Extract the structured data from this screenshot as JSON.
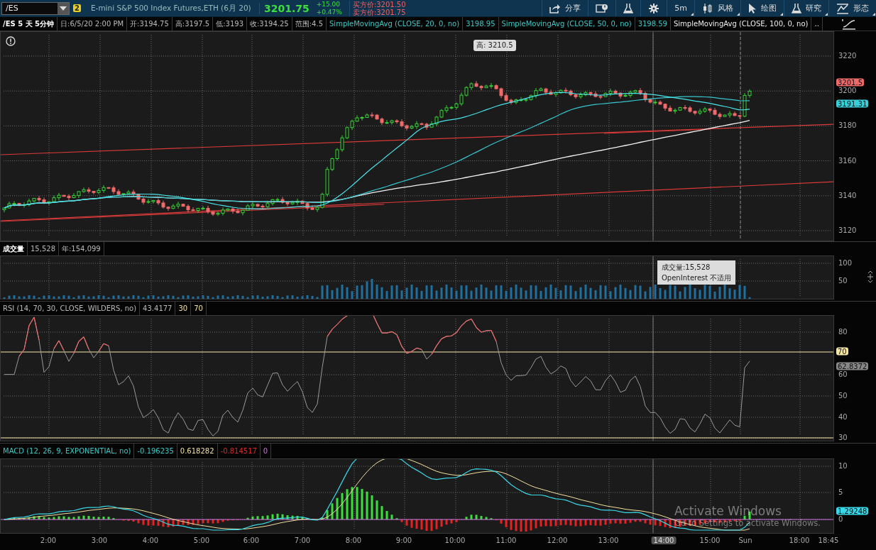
{
  "toolbar": {
    "symbol": "/ES",
    "link_badge": "2",
    "description": "E-mini S&P 500 Index Futures,ETH (6月 20)",
    "last": "3201.75",
    "change": "+15.00",
    "change_pct": "+0.47%",
    "bid": "买方价:3201.50",
    "ask": "卖方价:3201.75",
    "buttons": [
      {
        "label": "分享",
        "has_menu": false
      },
      {
        "has_menu": false
      },
      {
        "has_menu": false
      },
      {
        "has_menu": false
      },
      {
        "label": "5m",
        "has_menu": true
      },
      {
        "label": "风格",
        "has_menu": true
      },
      {
        "label": "绘图",
        "has_menu": true
      },
      {
        "label": "研究",
        "has_menu": true
      },
      {
        "label": "形态",
        "has_menu": true
      }
    ]
  },
  "info_bar": [
    {
      "text": "/ES 5 天 5分钟",
      "kind": "symbol"
    },
    {
      "text": "日:6/5/20 2:00 PM",
      "kind": "field"
    },
    {
      "text": "开:3194.75",
      "kind": "field"
    },
    {
      "text": "高:3197.5",
      "kind": "field"
    },
    {
      "text": "低:3193",
      "kind": "field"
    },
    {
      "text": "收:3194.25",
      "kind": "field"
    },
    {
      "text": "范围:4.5",
      "kind": "field"
    },
    {
      "text": "SimpleMovingAvg (CLOSE, 20, 0, no)",
      "kind": "sma"
    },
    {
      "text": "3198.95",
      "kind": "sma"
    },
    {
      "text": "SimpleMovingAvg (CLOSE, 50, 0, no)",
      "kind": "sma"
    },
    {
      "text": "3198.59",
      "kind": "sma"
    },
    {
      "text": "SimpleMovingAvg (CLOSE, 100, 0, no)",
      "kind": "sma_long"
    },
    {
      "text": "..",
      "kind": "sma_long"
    }
  ],
  "price_panel": {
    "y_labels": [
      "3220",
      "3200",
      "3180",
      "3160",
      "3140",
      "3120"
    ],
    "high_label": "高: 3210.5",
    "badges": [
      {
        "text": "3201.5",
        "color": "#f06a6a"
      },
      {
        "text": "3191.31",
        "color": "#38d0d8"
      }
    ]
  },
  "volume_panel": {
    "header": [
      {
        "text": "成交量",
        "kind": "symbol"
      },
      {
        "text": "15,528",
        "kind": "field"
      },
      {
        "text": "年:154,099",
        "kind": "field"
      }
    ],
    "y_labels": [
      "100",
      "50"
    ],
    "tooltip": [
      "成交量:15,528",
      "OpenInterest 不适用"
    ]
  },
  "rsi_panel": {
    "header": [
      {
        "text": "RSI (14, 70, 30, CLOSE, WILDERS, no)",
        "kind": "field"
      },
      {
        "text": "43.4177",
        "kind": "field"
      },
      {
        "text": "30",
        "kind": "level"
      },
      {
        "text": "70",
        "kind": "level"
      }
    ],
    "y_labels": [
      "80",
      "60",
      "50",
      "40",
      "30"
    ],
    "badges": [
      {
        "text": "70",
        "color": "#f5e6a8"
      },
      {
        "text": "62.8372",
        "color": "#888888"
      }
    ]
  },
  "macd_panel": {
    "header": [
      {
        "text": "MACD (12, 26, 9, EXPONENTIAL, no)",
        "kind": "macd"
      },
      {
        "text": "-0.196235",
        "kind": "macd"
      },
      {
        "text": "0.618282",
        "kind": "average"
      },
      {
        "text": "-0.814517",
        "kind": "diff"
      },
      {
        "text": "0",
        "kind": "zero"
      }
    ],
    "y_labels": [
      "10",
      "5",
      "0"
    ],
    "badges": [
      {
        "text": "1.29248",
        "color": "#38d8e8"
      }
    ]
  },
  "time_axis": [
    {
      "label": "2:00",
      "highlighted": false
    },
    {
      "label": "3:00",
      "highlighted": false
    },
    {
      "label": "4:00",
      "highlighted": false
    },
    {
      "label": "5:00",
      "highlighted": false
    },
    {
      "label": "6:00",
      "highlighted": false
    },
    {
      "label": "7:00",
      "highlighted": false
    },
    {
      "label": "8:00",
      "highlighted": false
    },
    {
      "label": "9:00",
      "highlighted": false
    },
    {
      "label": "10:00",
      "highlighted": false
    },
    {
      "label": "11:00",
      "highlighted": false
    },
    {
      "label": "12:00",
      "highlighted": false
    },
    {
      "label": "13:00",
      "highlighted": false
    },
    {
      "label": "14:00",
      "highlighted": true
    },
    {
      "label": "15:00",
      "highlighted": false
    },
    {
      "label": "Sun",
      "highlighted": false
    },
    {
      "label": "18:00",
      "highlighted": false
    },
    {
      "label": "18:45",
      "highlighted": false
    }
  ],
  "system_notice": [
    "Activate Windows",
    "Go to Settings to activate Windows."
  ]
}
